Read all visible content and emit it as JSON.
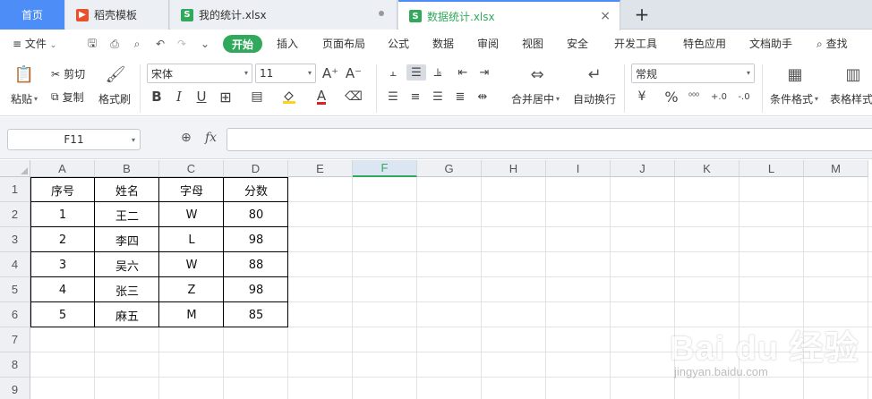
{
  "tabs": {
    "home": "首页",
    "docs": [
      {
        "label": "稻壳模板",
        "icon": "daoke-icon"
      },
      {
        "label": "我的统计.xlsx",
        "icon": "sheet-icon"
      },
      {
        "label": "数据统计.xlsx",
        "icon": "sheet-icon"
      }
    ],
    "new_tab": "+",
    "close": "×"
  },
  "menu": {
    "file": "文件",
    "start": "开始",
    "items": [
      "插入",
      "页面布局",
      "公式",
      "数据",
      "审阅",
      "视图",
      "安全",
      "开发工具",
      "特色应用",
      "文档助手"
    ],
    "search": "查找"
  },
  "ribbon": {
    "paste": "粘贴",
    "cut": "剪切",
    "copy": "复制",
    "format_painter": "格式刷",
    "font_name": "宋体",
    "font_size": "11",
    "bold": "B",
    "italic": "I",
    "underline": "U",
    "font_color_letter": "A",
    "merge_center": "合并居中",
    "wrap_text": "自动换行",
    "number_format": "常规",
    "percent": "%",
    "conditional_format": "条件格式",
    "table_style": "表格样式",
    "accent": "#31a95c",
    "font_color": "#e02020",
    "highlight_color": "#ffd21f"
  },
  "formula_bar": {
    "name_box": "F11",
    "fx": "fx",
    "value": ""
  },
  "grid": {
    "columns": [
      "A",
      "B",
      "C",
      "D",
      "E",
      "F",
      "G",
      "H",
      "I",
      "J",
      "K",
      "L",
      "M"
    ],
    "active_column": "F",
    "rows": [
      "1",
      "2",
      "3",
      "4",
      "5",
      "6",
      "7",
      "8",
      "9"
    ],
    "table": {
      "headers": [
        "序号",
        "姓名",
        "字母",
        "分数"
      ],
      "rows": [
        [
          "1",
          "王二",
          "W",
          "80"
        ],
        [
          "2",
          "李四",
          "L",
          "98"
        ],
        [
          "3",
          "吴六",
          "W",
          "88"
        ],
        [
          "4",
          "张三",
          "Z",
          "98"
        ],
        [
          "5",
          "麻五",
          "M",
          "85"
        ]
      ]
    }
  },
  "watermark": {
    "main": "Bai du 经验",
    "sub": "jingyan.baidu.com"
  }
}
